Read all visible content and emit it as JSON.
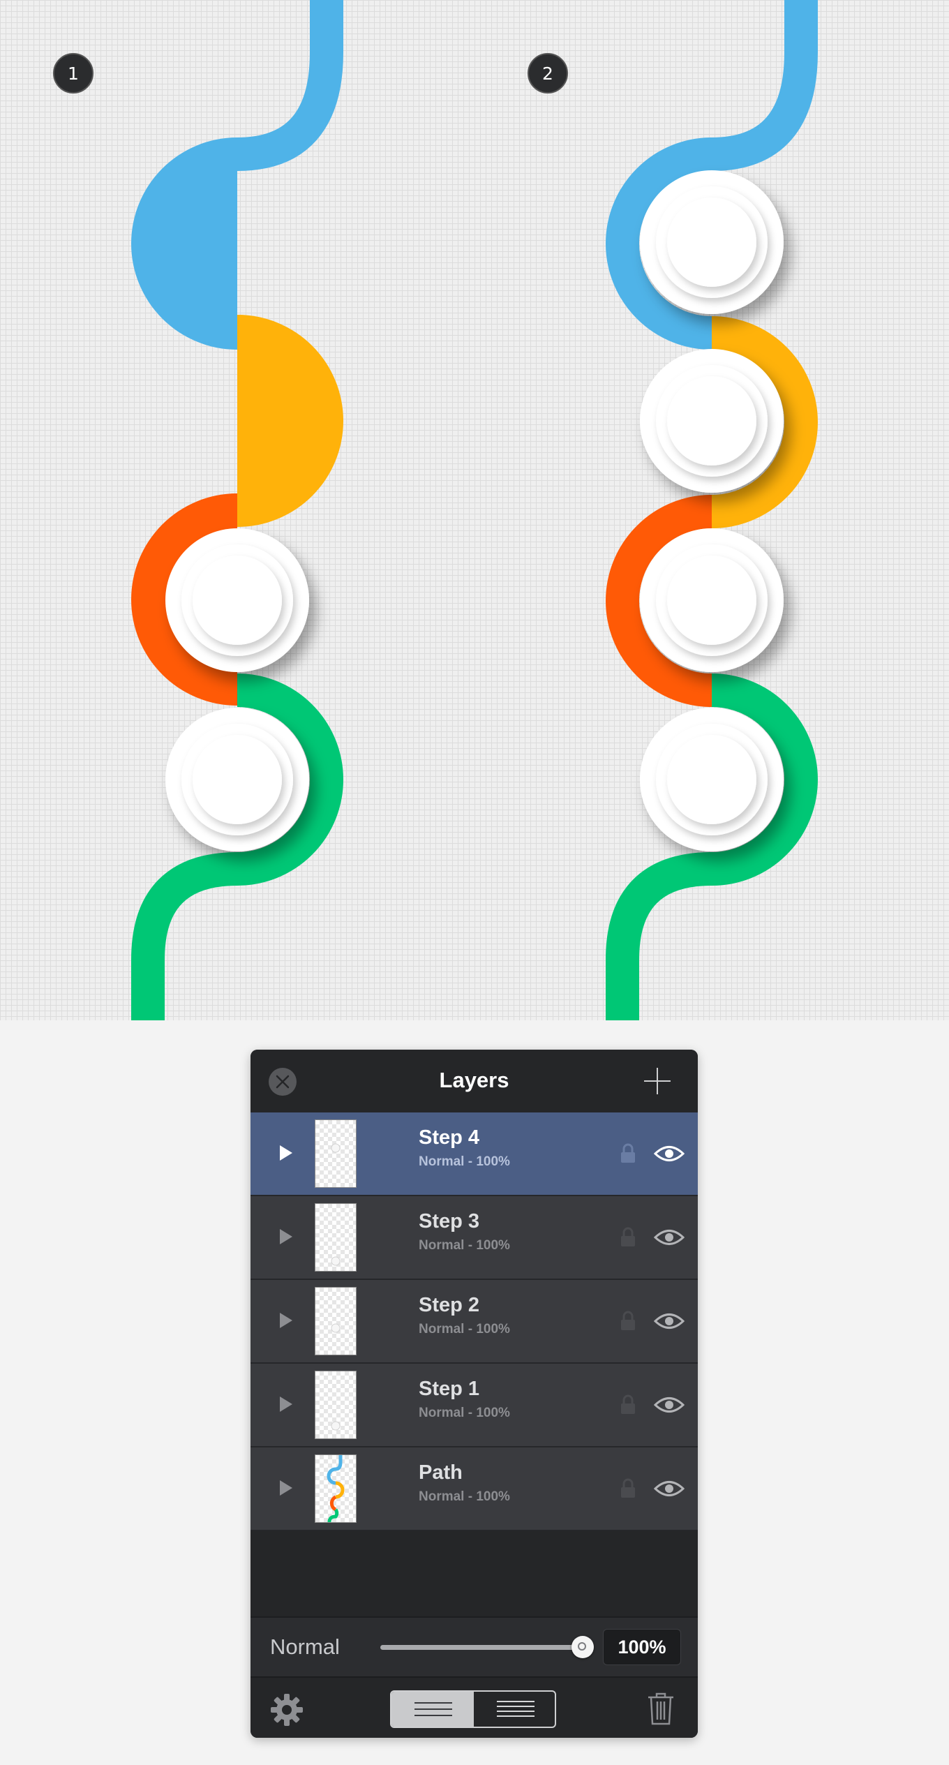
{
  "canvas": {
    "step_badges": [
      "1",
      "2"
    ],
    "colors": {
      "blue": "#4fb3e8",
      "yellow": "#ffb20a",
      "orange": "#ff5a06",
      "green": "#00c775",
      "button_face": "#ffffff"
    }
  },
  "layers_panel": {
    "title": "Layers",
    "layers": [
      {
        "name": "Step 4",
        "mode": "Normal - 100%",
        "selected": true
      },
      {
        "name": "Step 3",
        "mode": "Normal - 100%",
        "selected": false
      },
      {
        "name": "Step 2",
        "mode": "Normal - 100%",
        "selected": false
      },
      {
        "name": "Step 1",
        "mode": "Normal - 100%",
        "selected": false
      },
      {
        "name": "Path",
        "mode": "Normal - 100%",
        "selected": false
      }
    ],
    "blend_mode": "Normal",
    "opacity_text": "100%",
    "opacity_fraction": 1.0,
    "view_toggle_active": "left",
    "selection_color": "#4b5e85",
    "icons": [
      "close-icon",
      "plus-icon",
      "expand-arrow-icon",
      "lock-icon",
      "eye-icon",
      "gear-icon",
      "list-view-icon",
      "trash-icon"
    ]
  }
}
